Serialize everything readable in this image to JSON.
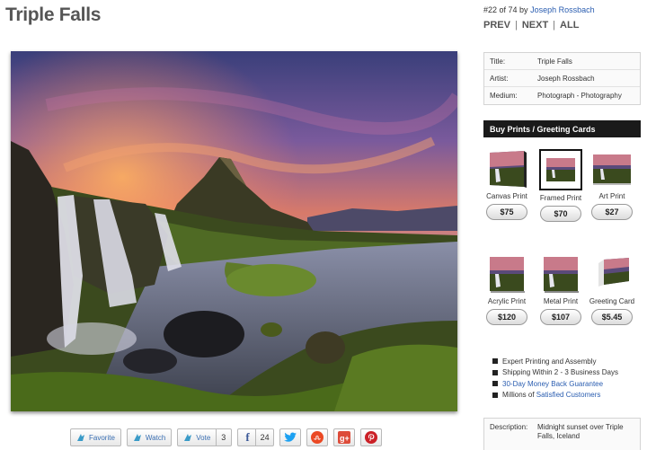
{
  "page": {
    "title": "Triple Falls"
  },
  "nav": {
    "position": "#22 of 74 by",
    "artist_link": "Joseph Rossbach",
    "prev": "PREV",
    "next": "NEXT",
    "all": "ALL",
    "separator": "|"
  },
  "info": [
    {
      "key": "Title:",
      "value": "Triple Falls"
    },
    {
      "key": "Artist:",
      "value": "Joseph Rossbach"
    },
    {
      "key": "Medium:",
      "value": "Photograph - Photography"
    }
  ],
  "buy": {
    "header": "Buy Prints / Greeting Cards",
    "products": [
      {
        "name": "Canvas Print",
        "price": "$75"
      },
      {
        "name": "Framed Print",
        "price": "$70"
      },
      {
        "name": "Art Print",
        "price": "$27"
      },
      {
        "name": "Acrylic Print",
        "price": "$120"
      },
      {
        "name": "Metal Print",
        "price": "$107"
      },
      {
        "name": "Greeting Card",
        "price": "$5.45"
      }
    ]
  },
  "features": [
    {
      "text": "Expert Printing and Assembly",
      "is_link": false
    },
    {
      "text": "Shipping Within 2 - 3 Business Days",
      "is_link": false
    },
    {
      "text": "30-Day Money Back Guarantee",
      "is_link": true
    },
    {
      "prefix": "Millions of ",
      "text": "Satisfied Customers",
      "is_link": true
    }
  ],
  "description": {
    "key": "Description:",
    "value": "Midnight sunset over Triple Falls, Iceland"
  },
  "share": {
    "favorite": "Favorite",
    "watch": "Watch",
    "vote": "Vote",
    "vote_count": "3",
    "facebook_count": "24",
    "facebook_glyph": "f"
  },
  "colors": {
    "link": "#2a5db0",
    "header_bg": "#1a1a1a",
    "facebook": "#3b5998",
    "twitter": "#1da1f2",
    "stumbleupon": "#eb4924",
    "google_plus": "#dd4b39",
    "pinterest": "#cb2027"
  }
}
